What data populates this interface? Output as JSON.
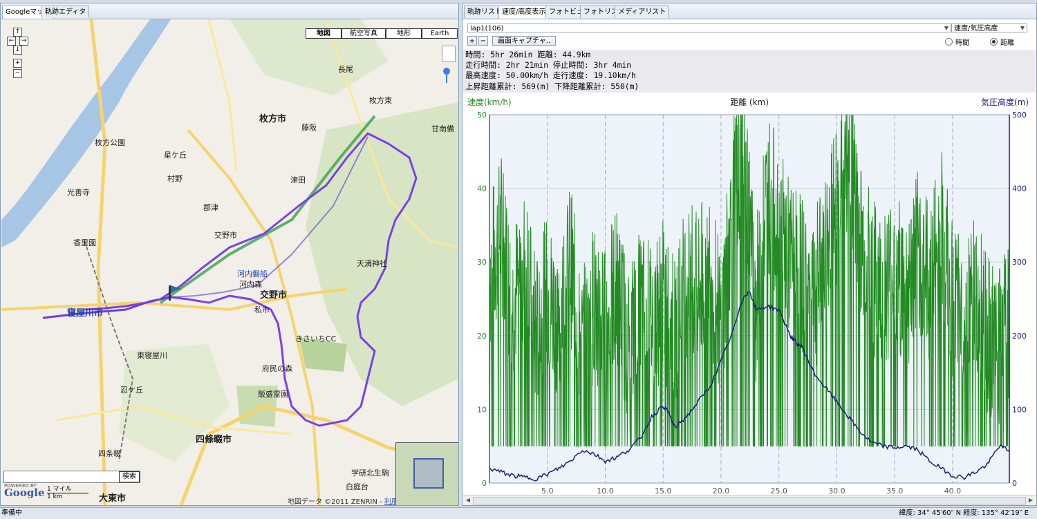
{
  "left_tabs": [
    "Googleマップ",
    "軌跡エディタ"
  ],
  "right_tabs": [
    "軌跡リスト",
    "速度/高度表示",
    "フォトビュー",
    "フォトリスト",
    "メディアリスト"
  ],
  "map": {
    "types": [
      "地図",
      "航空写真",
      "地形",
      "Earth"
    ],
    "nav": {
      "up": "↑",
      "down": "↓",
      "left": "←",
      "right": "→",
      "zoom_in": "+",
      "zoom_out": "−"
    },
    "search_button": "検索",
    "logo": "Google",
    "powered_by": "POWERED BY",
    "scale_mile": "1 マイル",
    "scale_km": "1 km",
    "copyright": "地図データ ©2011 ZENRIN",
    "terms": "利用規約",
    "labels": [
      {
        "text": "枚方市",
        "cls": "big"
      },
      {
        "text": "交野市",
        "cls": "big"
      },
      {
        "text": "寝屋川市",
        "cls": "big"
      },
      {
        "text": "四條畷市",
        "cls": "big"
      },
      {
        "text": "大東市",
        "cls": "big"
      },
      {
        "text": "藤阪",
        "cls": ""
      },
      {
        "text": "津田",
        "cls": ""
      },
      {
        "text": "枚方公園",
        "cls": ""
      },
      {
        "text": "光善寺",
        "cls": ""
      },
      {
        "text": "香里園",
        "cls": ""
      },
      {
        "text": "星ケ丘",
        "cls": ""
      },
      {
        "text": "村野",
        "cls": ""
      },
      {
        "text": "郡津",
        "cls": ""
      },
      {
        "text": "交野市",
        "cls": ""
      },
      {
        "text": "河内磐船",
        "cls": "blue"
      },
      {
        "text": "河内森",
        "cls": ""
      },
      {
        "text": "私市",
        "cls": ""
      },
      {
        "text": "東寝屋川",
        "cls": ""
      },
      {
        "text": "忍ケ丘",
        "cls": ""
      },
      {
        "text": "四条畷",
        "cls": ""
      },
      {
        "text": "学研北生駒",
        "cls": ""
      },
      {
        "text": "白庭台",
        "cls": ""
      },
      {
        "text": "長尾",
        "cls": ""
      },
      {
        "text": "枚方東",
        "cls": ""
      },
      {
        "text": "天満神社",
        "cls": ""
      },
      {
        "text": "きさいちCC",
        "cls": ""
      },
      {
        "text": "府民の森",
        "cls": ""
      },
      {
        "text": "飯盛霊園",
        "cls": ""
      },
      {
        "text": "甘南備",
        "cls": ""
      }
    ]
  },
  "selector": {
    "lap": "lap1(106)",
    "mode": "速度/気圧高度"
  },
  "buttons": {
    "plus": "+",
    "minus": "−",
    "capture": "画面キャプチャ.."
  },
  "radios": {
    "time": "時間",
    "distance": "距離",
    "selected": "distance"
  },
  "stats": [
    "時間: 5hr 26min 距離: 44.9km",
    "走行時間: 2hr 21min 停止時間: 3hr 4min",
    "最高速度: 50.00km/h 走行速度: 19.10km/h",
    "上昇距離累計: 569(m) 下降距離累計: 550(m)"
  ],
  "status": {
    "left": "準備中",
    "right": "緯度: 34° 45′60″ N 経度: 135° 42′19″ E"
  },
  "colors": {
    "speed": "#228b22",
    "altitude": "#1a1a80",
    "route": "#7b3ff0",
    "plot_bg": "#eef3fa"
  },
  "chart_data": {
    "type": "line",
    "title": "距離 (km)",
    "xlabel": "距離 (km)",
    "ylabel_left": "速度(km/h)",
    "ylabel_right": "気圧高度(m)",
    "xlim": [
      0,
      44.9
    ],
    "ylim_left": [
      0,
      50
    ],
    "ylim_right": [
      0,
      500
    ],
    "x_ticks": [
      "5.0",
      "10.0",
      "15.0",
      "20.0",
      "25.0",
      "30.0",
      "35.0",
      "40.0"
    ],
    "y_ticks_left": [
      "0",
      "10",
      "20",
      "30",
      "40",
      "50"
    ],
    "y_ticks_right": [
      "0",
      "100",
      "200",
      "300",
      "400",
      "500"
    ],
    "grid": true,
    "series": [
      {
        "name": "速度(km/h)",
        "axis": "left",
        "x": [
          0,
          1,
          2,
          3,
          4,
          5,
          6,
          7,
          8,
          9,
          10,
          11,
          12,
          13,
          14,
          15,
          16,
          17,
          18,
          19,
          20,
          21,
          22,
          23,
          24,
          25,
          26,
          27,
          28,
          29,
          30,
          31,
          32,
          33,
          34,
          35,
          36,
          37,
          38,
          39,
          40,
          41,
          42,
          43,
          44,
          44.9
        ],
        "y": [
          28,
          34,
          24,
          31,
          20,
          26,
          22,
          30,
          18,
          25,
          21,
          27,
          19,
          24,
          22,
          25,
          20,
          28,
          26,
          30,
          21,
          38,
          45,
          24,
          40,
          35,
          30,
          28,
          25,
          32,
          38,
          45,
          34,
          28,
          26,
          30,
          25,
          32,
          27,
          36,
          24,
          22,
          26,
          20,
          18,
          22
        ]
      },
      {
        "name": "気圧高度(m)",
        "axis": "right",
        "x": [
          0,
          1,
          2,
          3,
          4,
          5,
          6,
          7,
          8,
          9,
          10,
          11,
          12,
          13,
          14,
          15,
          15.5,
          16,
          17,
          18,
          19,
          20,
          21,
          22,
          22.5,
          23,
          24,
          25,
          26,
          26.5,
          27,
          28,
          29,
          30,
          31,
          32,
          33,
          34,
          35,
          36,
          37,
          38,
          39,
          40,
          41,
          42,
          43,
          44,
          44.9
        ],
        "y": [
          20,
          15,
          10,
          8,
          6,
          12,
          20,
          30,
          45,
          40,
          30,
          35,
          45,
          60,
          90,
          105,
          95,
          75,
          90,
          110,
          130,
          165,
          205,
          255,
          260,
          235,
          240,
          235,
          200,
          190,
          185,
          150,
          130,
          110,
          90,
          70,
          55,
          50,
          48,
          50,
          45,
          30,
          20,
          10,
          8,
          15,
          25,
          50,
          45
        ]
      }
    ]
  }
}
